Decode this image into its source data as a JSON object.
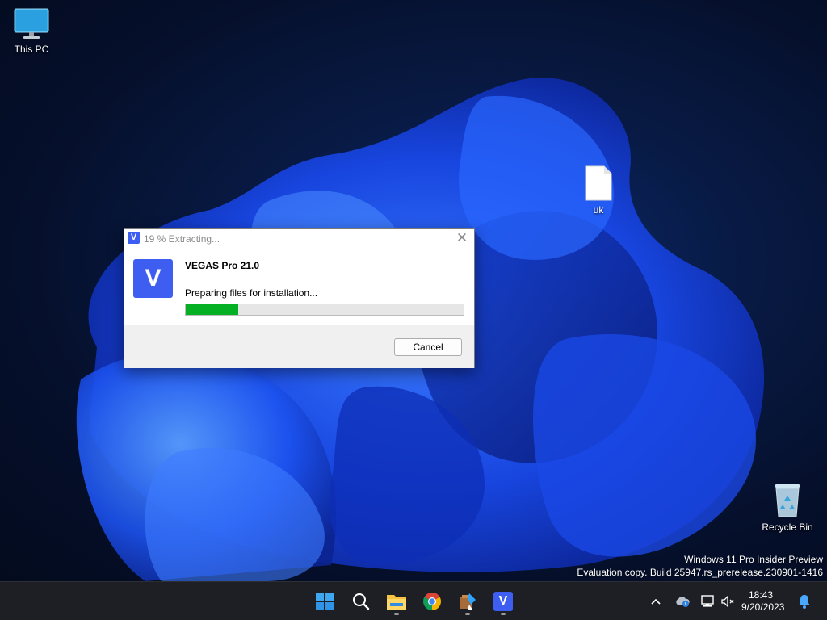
{
  "desktop": {
    "icons": [
      {
        "label": "This PC",
        "icon": "monitor-icon"
      },
      {
        "label": "uk",
        "icon": "file-icon"
      },
      {
        "label": "Recycle Bin",
        "icon": "recycle-bin-icon"
      }
    ],
    "watermark": {
      "line1": "Windows 11 Pro Insider Preview",
      "line2": "Evaluation copy. Build 25947.rs_prerelease.230901-1416"
    }
  },
  "dialog": {
    "title": "19 % Extracting...",
    "title_icon_letter": "V",
    "close_glyph": "✕",
    "app_logo_letter": "V",
    "app_name": "VEGAS Pro 21.0",
    "status": "Preparing files for installation...",
    "progress": 0.19,
    "cancel_label": "Cancel",
    "colors": {
      "brand": "#3d5ef1",
      "progress": "#06b025"
    }
  },
  "taskbar": {
    "pinned": [
      {
        "name": "start-icon",
        "running": false
      },
      {
        "name": "search-icon",
        "running": false
      },
      {
        "name": "file-explorer-icon",
        "running": true
      },
      {
        "name": "chrome-icon",
        "running": false
      },
      {
        "name": "setup-icon",
        "running": true
      },
      {
        "name": "vegas-icon",
        "running": true,
        "letter": "V"
      }
    ],
    "tray": [
      "chevron-up-icon",
      "onedrive-icon",
      "network-icon",
      "volume-muted-icon"
    ],
    "clock": {
      "time": "18:43",
      "date": "9/20/2023"
    },
    "notification_icon": "bell-icon"
  }
}
